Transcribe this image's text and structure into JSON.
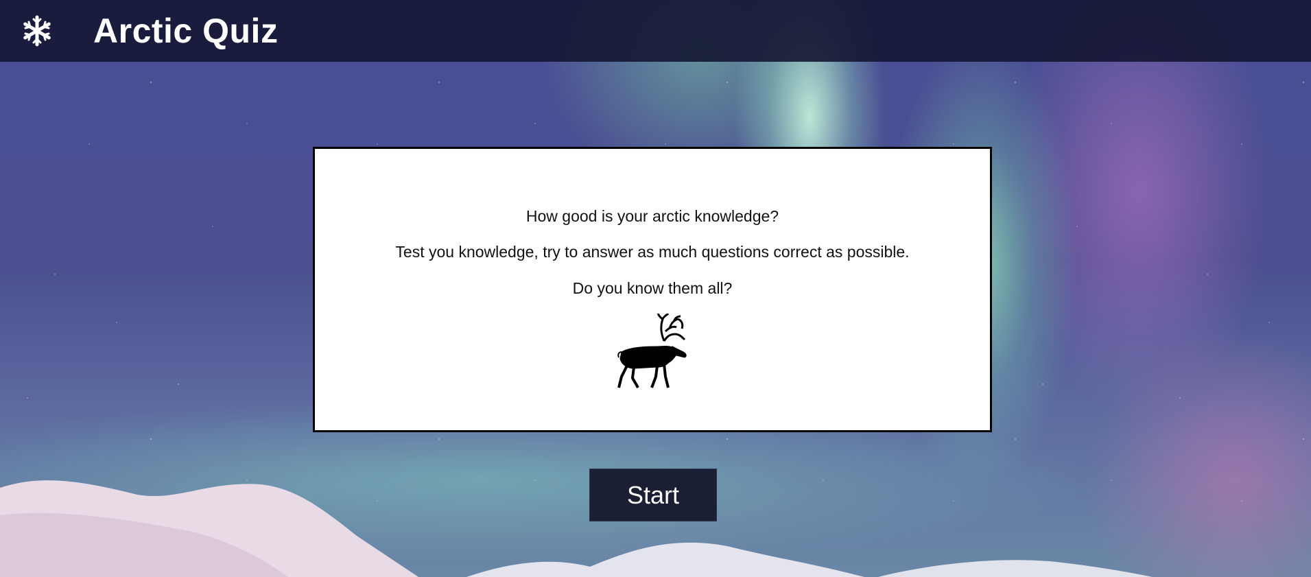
{
  "header": {
    "logo_icon": "snowflake-icon",
    "title": "Arctic Quiz"
  },
  "intro": {
    "line1": "How good is your arctic knowledge?",
    "line2": "Test you knowledge, try to answer as much questions correct as possible.",
    "line3": "Do you know them all?",
    "image_icon": "reindeer-icon"
  },
  "actions": {
    "start_label": "Start"
  },
  "colors": {
    "header_bg": "#14163a",
    "button_bg": "#1b1f33",
    "card_bg": "#ffffff",
    "card_border": "#000000"
  }
}
